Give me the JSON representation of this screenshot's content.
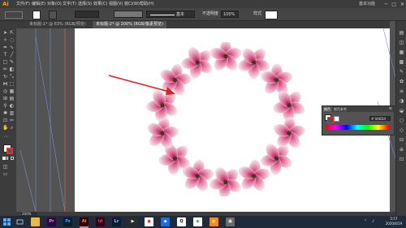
{
  "app": {
    "logo": "Ai",
    "workspace": "基本功能",
    "window_controls": [
      "─",
      "□",
      "✕"
    ]
  },
  "menus": [
    "文件(F)",
    "编辑(E)",
    "对象(O)",
    "文字(T)",
    "选择(S)",
    "效果(C)",
    "视图(V)",
    "窗口(W)",
    "帮助(H)"
  ],
  "controlbar": {
    "stroke_profile": "基本",
    "opacity_label": "不透明度",
    "opacity": "100%",
    "style_label": "样式"
  },
  "tabs": [
    {
      "label": "未标题-1* @ 83% (RGB/预览)",
      "active": false
    },
    {
      "label": "未标题-2* @ 200% (RGB/像素预览)",
      "active": true
    }
  ],
  "color_panel": {
    "tabs": [
      "颜色",
      "颜色参考"
    ],
    "hex": "# 0A6D4",
    "active_tab": 0
  },
  "status": {
    "zoom": "200%"
  },
  "taskbar": {
    "apps": [
      {
        "name": "explorer",
        "label": "",
        "color": "#e8b84a",
        "fg": "#5a3d00"
      },
      {
        "name": "premiere",
        "label": "Pr",
        "color": "#2a0a3e",
        "fg": "#e38cff"
      },
      {
        "name": "photoshop",
        "label": "Ps",
        "color": "#0a1e33",
        "fg": "#31a8ff"
      },
      {
        "name": "illustrator",
        "label": "Ai",
        "color": "#330000",
        "fg": "#ff9a00",
        "active": true
      },
      {
        "name": "indesign",
        "label": "Id",
        "color": "#3a0015",
        "fg": "#ff3366"
      },
      {
        "name": "lightroom",
        "label": "Lr",
        "color": "#0a1e33",
        "fg": "#9ad3ff"
      },
      {
        "name": "media-app",
        "label": "▶",
        "color": "#2b2b2b",
        "fg": "#ffffff"
      },
      {
        "name": "app-red",
        "label": "●",
        "color": "#ffffff",
        "fg": "#e83b3b"
      },
      {
        "name": "app-blue",
        "label": "◆",
        "color": "#1d6fd8",
        "fg": "#ffffff"
      },
      {
        "name": "qq",
        "label": "Q",
        "color": "#ffffff",
        "fg": "#111111"
      },
      {
        "name": "chrome",
        "label": "◉",
        "color": "#ffffff",
        "fg": "#2a9d44"
      },
      {
        "name": "app-orange",
        "label": "◐",
        "color": "#f28a1a",
        "fg": "#ffffff"
      },
      {
        "name": "app-gray",
        "label": "▣",
        "color": "#6a6a6a",
        "fg": "#ffffff"
      }
    ],
    "time": "5:57",
    "date": "2020/4/19"
  }
}
